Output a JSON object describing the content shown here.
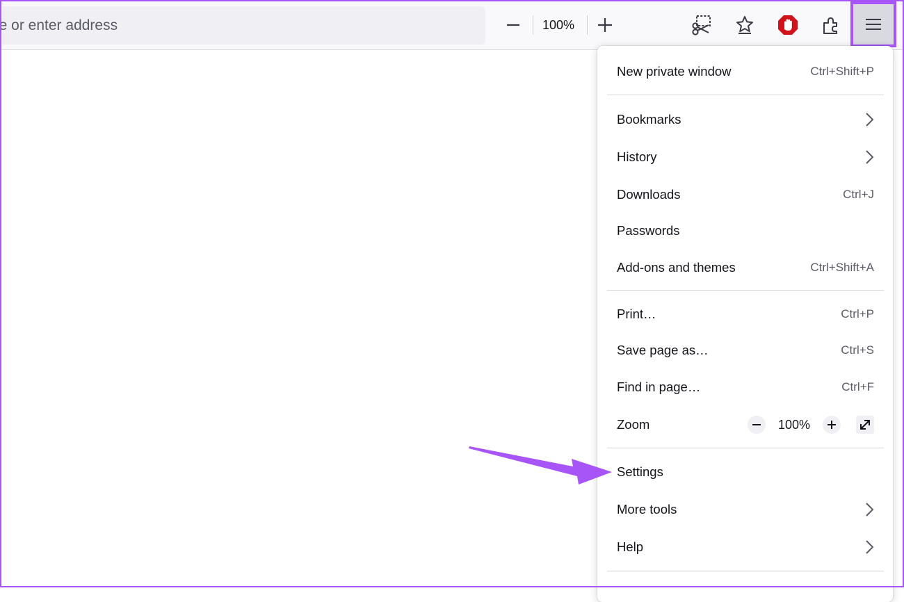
{
  "toolbar": {
    "address_placeholder": "le or enter address",
    "zoom_value": "100%",
    "icons": {
      "zoom_out": "minus-icon",
      "zoom_in": "plus-icon",
      "screenshot": "screenshot-scissors-icon",
      "bookmark_star": "bookmark-star-icon",
      "adblock": "stop-hand-icon",
      "extensions": "puzzle-piece-icon",
      "menu": "hamburger-menu-icon"
    }
  },
  "menu": {
    "items": [
      {
        "label": "New private window",
        "shortcut": "Ctrl+Shift+P"
      },
      {
        "label": "Bookmarks"
      },
      {
        "label": "History"
      },
      {
        "label": "Downloads",
        "shortcut": "Ctrl+J"
      },
      {
        "label": "Passwords"
      },
      {
        "label": "Add-ons and themes",
        "shortcut": "Ctrl+Shift+A"
      },
      {
        "label": "Print…",
        "shortcut": "Ctrl+P"
      },
      {
        "label": "Save page as…",
        "shortcut": "Ctrl+S"
      },
      {
        "label": "Find in page…",
        "shortcut": "Ctrl+F"
      },
      {
        "label": "Zoom",
        "value": "100%"
      },
      {
        "label": "Settings"
      },
      {
        "label": "More tools"
      },
      {
        "label": "Help"
      }
    ]
  },
  "colors": {
    "highlight": "#a855f7",
    "adblock_red": "#d0131b",
    "menu_text": "#15141a",
    "shortcut_text": "#5b5b66"
  }
}
